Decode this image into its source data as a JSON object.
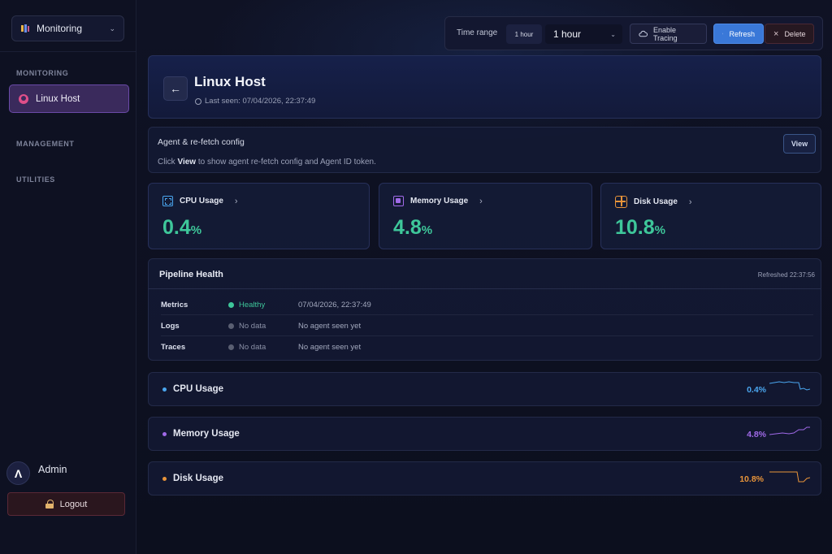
{
  "sidebar": {
    "app_switcher_label": "Monitoring",
    "sections": {
      "monitoring": "MONITORING",
      "management": "MANAGEMENT",
      "utilities": "UTILITIES"
    },
    "active_item": "Linux Host",
    "user": {
      "initial": "Λ",
      "name": "Admin"
    },
    "logout_label": "Logout"
  },
  "toolbar": {
    "time_range_label": "Time range",
    "range_pill": "1 hour",
    "range_selected": "1 hour",
    "enable_tracing_label": "Enable Tracing",
    "refresh_label": "Refresh",
    "delete_label": "Delete"
  },
  "host": {
    "title": "Linux Host",
    "last_seen": "Last seen: 07/04/2026, 22:37:49"
  },
  "config": {
    "title": "Agent & re-fetch config",
    "desc_prefix": "Click ",
    "desc_bold": "View",
    "desc_suffix": " to show agent re-fetch config and Agent ID token.",
    "view_label": "View"
  },
  "stats": [
    {
      "label": "CPU Usage",
      "value": "0.4",
      "unit": "%"
    },
    {
      "label": "Memory Usage",
      "value": "4.8",
      "unit": "%"
    },
    {
      "label": "Disk Usage",
      "value": "10.8",
      "unit": "%"
    }
  ],
  "pipeline": {
    "title": "Pipeline Health",
    "refreshed": "Refreshed 22:37:56",
    "rows": [
      {
        "name": "Metrics",
        "status": "Healthy",
        "detail": "07/04/2026, 22:37:49"
      },
      {
        "name": "Logs",
        "status": "No data",
        "detail": "No agent seen yet"
      },
      {
        "name": "Traces",
        "status": "No data",
        "detail": "No agent seen yet"
      }
    ]
  },
  "metrics": [
    {
      "label": "CPU Usage",
      "value": "0.4%",
      "color": "#4aa6ef"
    },
    {
      "label": "Memory Usage",
      "value": "4.8%",
      "color": "#a06ae8"
    },
    {
      "label": "Disk Usage",
      "value": "10.8%",
      "color": "#e8943a"
    }
  ],
  "colors": {
    "accent": "#3a78d8",
    "healthy": "#3ec79a",
    "cpu": "#4aa6ef",
    "memory": "#a06ae8",
    "disk": "#e8943a"
  }
}
